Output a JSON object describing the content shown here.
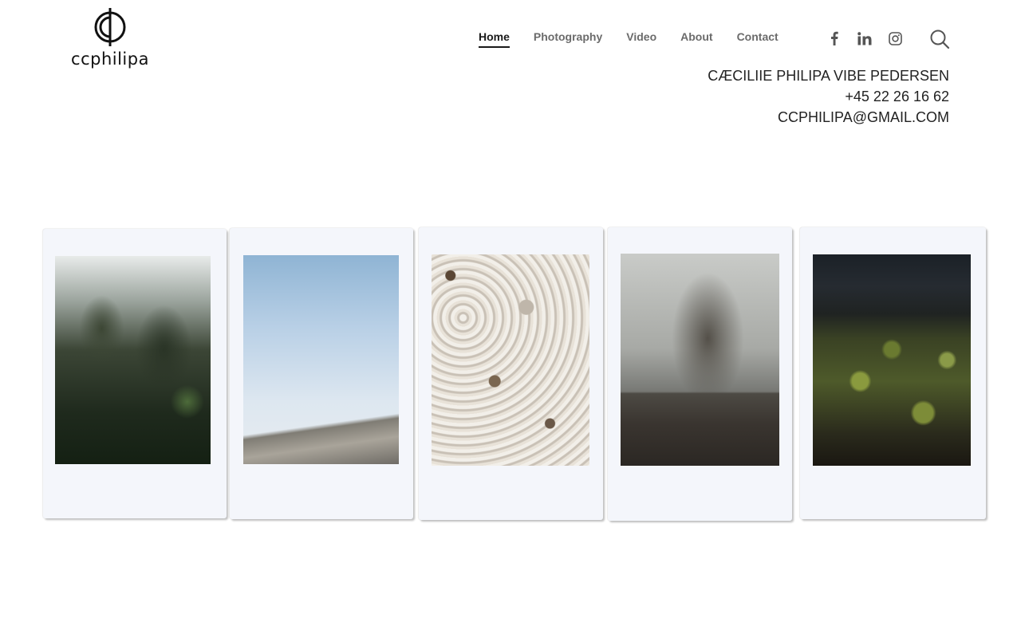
{
  "brand": {
    "logo_text": "ccphilipa"
  },
  "nav": {
    "items": [
      {
        "label": "Home",
        "active": true
      },
      {
        "label": "Photography",
        "active": false
      },
      {
        "label": "Video",
        "active": false
      },
      {
        "label": "About",
        "active": false
      },
      {
        "label": "Contact",
        "active": false
      }
    ]
  },
  "social": {
    "icons": [
      "facebook-icon",
      "linkedin-icon",
      "instagram-icon"
    ],
    "search_icon": "search-icon"
  },
  "contact": {
    "name": "CÆCILIIE PHILIPA VIBE PEDERSEN",
    "phone": "+45 22 26 16 62",
    "email": "CCPHILIPA@GMAIL.COM"
  },
  "gallery": {
    "photos": [
      {
        "subject": "forest"
      },
      {
        "subject": "beach"
      },
      {
        "subject": "shells"
      },
      {
        "subject": "tree"
      },
      {
        "subject": "moss"
      }
    ]
  },
  "colors": {
    "text": "#1f1f1f",
    "nav_inactive": "#6b6b6b",
    "background": "#ffffff",
    "polaroid_frame": "#f4f6fb"
  }
}
